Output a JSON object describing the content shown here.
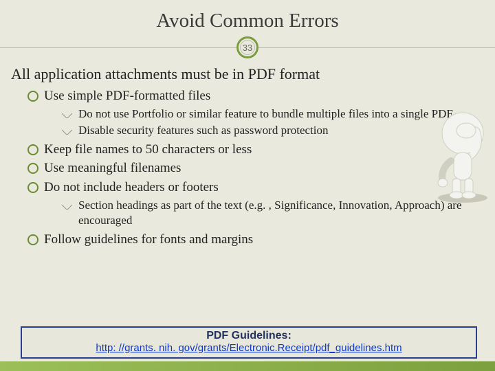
{
  "title": "Avoid Common Errors",
  "page_number": "33",
  "subtitle": "All application attachments must be in PDF format",
  "bullets": {
    "b1": "Use simple PDF-formatted files",
    "b1_1": "Do not use Portfolio or similar feature to bundle multiple files into a single PDF",
    "b1_2": "Disable security features such as password protection",
    "b2": "Keep file names to 50 characters or less",
    "b3": "Use meaningful filenames",
    "b4": "Do not include headers or footers",
    "b4_1": "Section headings as part of the text (e.g. , Significance, Innovation, Approach) are encouraged",
    "b5": "Follow guidelines for fonts and margins"
  },
  "footer": {
    "title": "PDF Guidelines:",
    "link": "http: //grants. nih. gov/grants/Electronic.Receipt/pdf_guidelines.htm"
  }
}
